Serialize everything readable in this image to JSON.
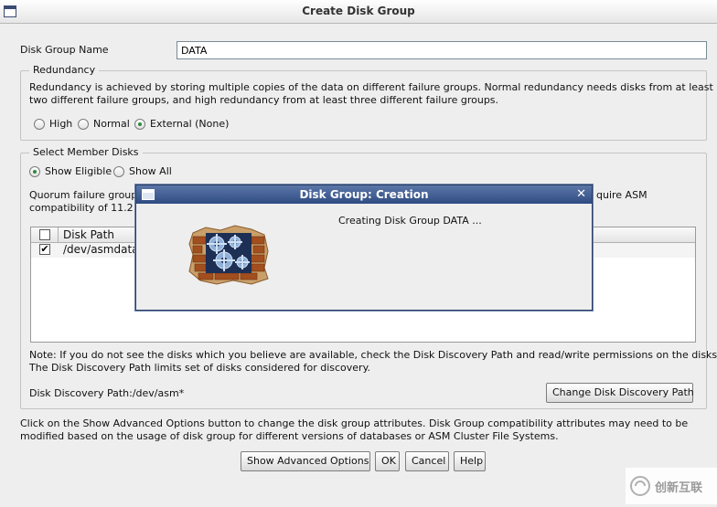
{
  "window": {
    "title": "Create Disk Group"
  },
  "disk_group_name": {
    "label": "Disk Group Name",
    "value": "DATA"
  },
  "redundancy": {
    "title": "Redundancy",
    "description_line1": "Redundancy is achieved by storing multiple copies of the data on different failure groups. Normal redundancy needs disks from at least",
    "description_line2": "two different failure groups, and high redundancy from at least three different failure groups.",
    "options": [
      "High",
      "Normal",
      "External (None)"
    ],
    "selected": "External (None)"
  },
  "member_disks": {
    "title": "Select Member Disks",
    "filter_options": [
      "Show Eligible",
      "Show All"
    ],
    "selected_filter": "Show Eligible",
    "quorum_line1_left": "Quorum failure group",
    "quorum_line1_right": "quire ASM",
    "quorum_line2_left": "compatibility of 11.2 c",
    "table": {
      "columns": [
        "Disk Path"
      ],
      "rows": [
        {
          "checked": true,
          "path": "/dev/asmdata"
        }
      ]
    },
    "note_line1": "Note: If you do not see the disks which you believe are available, check the Disk Discovery Path and read/write permissions on the disks.",
    "note_line2": "The Disk Discovery Path limits set of disks considered for discovery.",
    "discovery_path_label": "Disk Discovery Path:/dev/asm*",
    "change_path_button": "Change Disk Discovery Path"
  },
  "advanced_text_line1": "Click on the Show Advanced Options button to change the disk group attributes. Disk Group compatibility attributes may need to be",
  "advanced_text_line2": "modified based on the usage of disk group for different versions of databases or ASM Cluster File Systems.",
  "buttons": {
    "advanced": "Show Advanced Options",
    "ok": "OK",
    "cancel": "Cancel",
    "help": "Help"
  },
  "modal": {
    "title": "Disk Group: Creation",
    "message": "Creating Disk Group DATA ...",
    "close_glyph": "✕"
  },
  "watermark": {
    "text": "创新互联"
  },
  "colors": {
    "modal_bar": "#2f4c82",
    "radio_dot": "#2e8b3a"
  }
}
